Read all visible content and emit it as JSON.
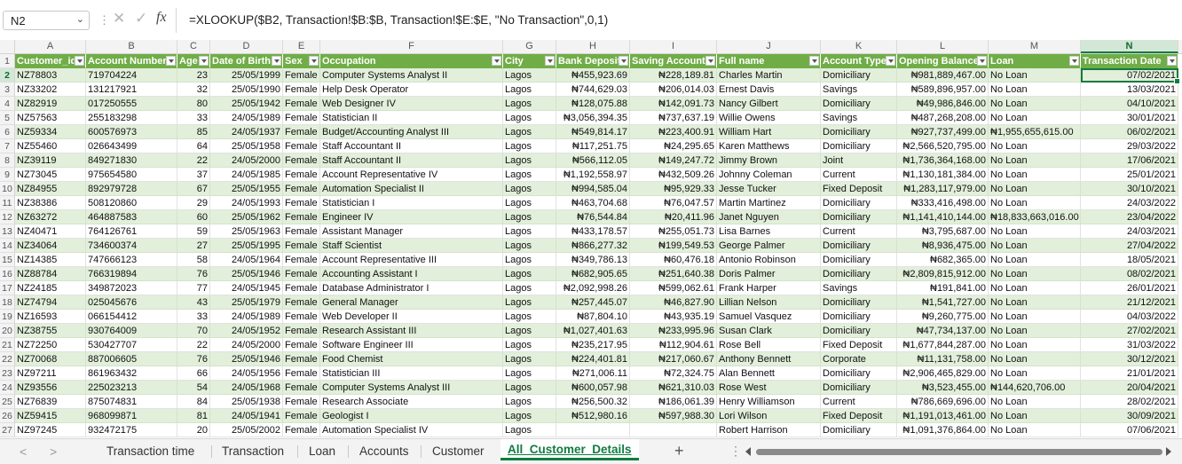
{
  "namebox": {
    "value": "N2"
  },
  "formula": {
    "fx": "fx",
    "text": "=XLOOKUP($B2, Transaction!$B:$B, Transaction!$E:$E, \"No Transaction\",0,1)"
  },
  "columns": [
    "A",
    "B",
    "C",
    "D",
    "E",
    "F",
    "G",
    "H",
    "I",
    "J",
    "K",
    "L",
    "M",
    "N"
  ],
  "selected_column": "N",
  "headers": [
    "Customer_id",
    "Account Number",
    "Age",
    "Date of Birth",
    "Sex",
    "Occupation",
    "City",
    "Bank Deposit",
    "Saving Accounts",
    "Full name",
    "Account Type",
    "Opening Balance",
    "Loan",
    "Transaction Date"
  ],
  "rows": [
    [
      "NZ78803",
      "719704224",
      "23",
      "25/05/1999",
      "Female",
      "Computer Systems Analyst II",
      "Lagos",
      "₦455,923.69",
      "₦228,189.81",
      "Charles Martin",
      "Domiciliary",
      "₦981,889,467.00",
      "No Loan",
      "07/02/2021"
    ],
    [
      "NZ33202",
      "131217921",
      "32",
      "25/05/1990",
      "Female",
      "Help Desk Operator",
      "Lagos",
      "₦744,629.03",
      "₦206,014.03",
      "Ernest Davis",
      "Savings",
      "₦589,896,957.00",
      "No Loan",
      "13/03/2021"
    ],
    [
      "NZ82919",
      "017250555",
      "80",
      "25/05/1942",
      "Female",
      "Web Designer IV",
      "Lagos",
      "₦128,075.88",
      "₦142,091.73",
      "Nancy Gilbert",
      "Domiciliary",
      "₦49,986,846.00",
      "No Loan",
      "04/10/2021"
    ],
    [
      "NZ57563",
      "255183298",
      "33",
      "24/05/1989",
      "Female",
      "Statistician II",
      "Lagos",
      "₦3,056,394.35",
      "₦737,637.19",
      "Willie Owens",
      "Savings",
      "₦487,268,208.00",
      "No Loan",
      "30/01/2021"
    ],
    [
      "NZ59334",
      "600576973",
      "85",
      "24/05/1937",
      "Female",
      "Budget/Accounting Analyst III",
      "Lagos",
      "₦549,814.17",
      "₦223,400.91",
      "William Hart",
      "Domiciliary",
      "₦927,737,499.00",
      "₦1,955,655,615.00",
      "06/02/2021"
    ],
    [
      "NZ55460",
      "026643499",
      "64",
      "25/05/1958",
      "Female",
      "Staff Accountant II",
      "Lagos",
      "₦117,251.75",
      "₦24,295.65",
      "Karen Matthews",
      "Domiciliary",
      "₦2,566,520,795.00",
      "No Loan",
      "29/03/2022"
    ],
    [
      "NZ39119",
      "849271830",
      "22",
      "24/05/2000",
      "Female",
      "Staff Accountant II",
      "Lagos",
      "₦566,112.05",
      "₦149,247.72",
      "Jimmy Brown",
      "Joint",
      "₦1,736,364,168.00",
      "No Loan",
      "17/06/2021"
    ],
    [
      "NZ73045",
      "975654580",
      "37",
      "24/05/1985",
      "Female",
      "Account Representative IV",
      "Lagos",
      "₦1,192,558.97",
      "₦432,509.26",
      "Johnny Coleman",
      "Current",
      "₦1,130,181,384.00",
      "No Loan",
      "25/01/2021"
    ],
    [
      "NZ84955",
      "892979728",
      "67",
      "25/05/1955",
      "Female",
      "Automation Specialist II",
      "Lagos",
      "₦994,585.04",
      "₦95,929.33",
      "Jesse Tucker",
      "Fixed Deposit",
      "₦1,283,117,979.00",
      "No Loan",
      "30/10/2021"
    ],
    [
      "NZ38386",
      "508120860",
      "29",
      "24/05/1993",
      "Female",
      "Statistician I",
      "Lagos",
      "₦463,704.68",
      "₦76,047.57",
      "Martin Martinez",
      "Domiciliary",
      "₦333,416,498.00",
      "No Loan",
      "24/03/2022"
    ],
    [
      "NZ63272",
      "464887583",
      "60",
      "25/05/1962",
      "Female",
      "Engineer IV",
      "Lagos",
      "₦76,544.84",
      "₦20,411.96",
      "Janet Nguyen",
      "Domiciliary",
      "₦1,141,410,144.00",
      "₦18,833,663,016.00",
      "23/04/2022"
    ],
    [
      "NZ40471",
      "764126761",
      "59",
      "25/05/1963",
      "Female",
      "Assistant Manager",
      "Lagos",
      "₦433,178.57",
      "₦255,051.73",
      "Lisa Barnes",
      "Current",
      "₦3,795,687.00",
      "No Loan",
      "24/03/2021"
    ],
    [
      "NZ34064",
      "734600374",
      "27",
      "25/05/1995",
      "Female",
      "Staff Scientist",
      "Lagos",
      "₦866,277.32",
      "₦199,549.53",
      "George Palmer",
      "Domiciliary",
      "₦8,936,475.00",
      "No Loan",
      "27/04/2022"
    ],
    [
      "NZ14385",
      "747666123",
      "58",
      "24/05/1964",
      "Female",
      "Account Representative III",
      "Lagos",
      "₦349,786.13",
      "₦60,476.18",
      "Antonio Robinson",
      "Domiciliary",
      "₦682,365.00",
      "No Loan",
      "18/05/2021"
    ],
    [
      "NZ88784",
      "766319894",
      "76",
      "25/05/1946",
      "Female",
      "Accounting Assistant I",
      "Lagos",
      "₦682,905.65",
      "₦251,640.38",
      "Doris Palmer",
      "Domiciliary",
      "₦2,809,815,912.00",
      "No Loan",
      "08/02/2021"
    ],
    [
      "NZ24185",
      "349872023",
      "77",
      "24/05/1945",
      "Female",
      "Database Administrator I",
      "Lagos",
      "₦2,092,998.26",
      "₦599,062.61",
      "Frank Harper",
      "Savings",
      "₦191,841.00",
      "No Loan",
      "26/01/2021"
    ],
    [
      "NZ74794",
      "025045676",
      "43",
      "25/05/1979",
      "Female",
      "General Manager",
      "Lagos",
      "₦257,445.07",
      "₦46,827.90",
      "Lillian Nelson",
      "Domiciliary",
      "₦1,541,727.00",
      "No Loan",
      "21/12/2021"
    ],
    [
      "NZ16593",
      "066154412",
      "33",
      "24/05/1989",
      "Female",
      "Web Developer II",
      "Lagos",
      "₦87,804.10",
      "₦43,935.19",
      "Samuel Vasquez",
      "Domiciliary",
      "₦9,260,775.00",
      "No Loan",
      "04/03/2022"
    ],
    [
      "NZ38755",
      "930764009",
      "70",
      "24/05/1952",
      "Female",
      "Research Assistant III",
      "Lagos",
      "₦1,027,401.63",
      "₦233,995.96",
      "Susan Clark",
      "Domiciliary",
      "₦47,734,137.00",
      "No Loan",
      "27/02/2021"
    ],
    [
      "NZ72250",
      "530427707",
      "22",
      "24/05/2000",
      "Female",
      "Software Engineer III",
      "Lagos",
      "₦235,217.95",
      "₦112,904.61",
      "Rose Bell",
      "Fixed Deposit",
      "₦1,677,844,287.00",
      "No Loan",
      "31/03/2022"
    ],
    [
      "NZ70068",
      "887006605",
      "76",
      "25/05/1946",
      "Female",
      "Food Chemist",
      "Lagos",
      "₦224,401.81",
      "₦217,060.67",
      "Anthony Bennett",
      "Corporate",
      "₦11,131,758.00",
      "No Loan",
      "30/12/2021"
    ],
    [
      "NZ97211",
      "861963432",
      "66",
      "24/05/1956",
      "Female",
      "Statistician III",
      "Lagos",
      "₦271,006.11",
      "₦72,324.75",
      "Alan Bennett",
      "Domiciliary",
      "₦2,906,465,829.00",
      "No Loan",
      "21/01/2021"
    ],
    [
      "NZ93556",
      "225023213",
      "54",
      "24/05/1968",
      "Female",
      "Computer Systems Analyst III",
      "Lagos",
      "₦600,057.98",
      "₦621,310.03",
      "Rose West",
      "Domiciliary",
      "₦3,523,455.00",
      "₦144,620,706.00",
      "20/04/2021"
    ],
    [
      "NZ76839",
      "875074831",
      "84",
      "25/05/1938",
      "Female",
      "Research Associate",
      "Lagos",
      "₦256,500.32",
      "₦186,061.39",
      "Henry Williamson",
      "Current",
      "₦786,669,696.00",
      "No Loan",
      "28/02/2021"
    ],
    [
      "NZ59415",
      "968099871",
      "81",
      "24/05/1941",
      "Female",
      "Geologist I",
      "Lagos",
      "₦512,980.16",
      "₦597,988.30",
      "Lori Wilson",
      "Fixed Deposit",
      "₦1,191,013,461.00",
      "No Loan",
      "30/09/2021"
    ],
    [
      "NZ97245",
      "932472175",
      "20",
      "25/05/2002",
      "Female",
      "Automation Specialist IV",
      "Lagos",
      "",
      "",
      "Robert Harrison",
      "Domiciliary",
      "₦1,091,376,864.00",
      "No Loan",
      "07/06/2021"
    ]
  ],
  "sheet_tabs": [
    "Transaction time",
    "Transaction",
    "Loan",
    "Accounts",
    "Customer",
    "All_Customer_Details"
  ],
  "active_tab": "All_Customer_Details",
  "colors": {
    "header_fill": "#70ad47",
    "band_fill": "#e2efda",
    "accent": "#107c41"
  }
}
